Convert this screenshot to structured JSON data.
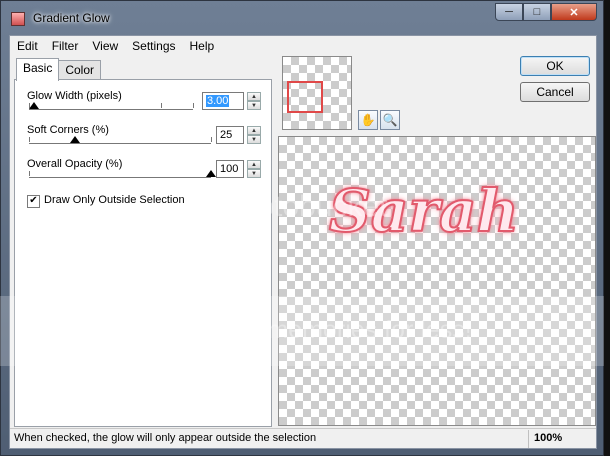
{
  "window": {
    "title": "Gradient Glow",
    "controls": {
      "minimize": "─",
      "maximize": "□",
      "close": "✕"
    }
  },
  "menu": [
    "Edit",
    "Filter",
    "View",
    "Settings",
    "Help"
  ],
  "tabs": {
    "basic": "Basic",
    "color": "Color"
  },
  "settings": {
    "glow_width": {
      "label": "Glow Width (pixels)",
      "value": "3.00",
      "level": 0.03
    },
    "soft_corners": {
      "label": "Soft Corners (%)",
      "value": "25",
      "level": 0.25
    },
    "overall_opacity": {
      "label": "Overall Opacity (%)",
      "value": "100",
      "level": 1.0
    },
    "draw_only_outside": {
      "label": "Draw Only Outside Selection",
      "checked": true
    }
  },
  "preview": {
    "text": "Sarah",
    "small_text": "Sarah",
    "glow_color": "#e25a6c"
  },
  "tools": {
    "hand": "✋",
    "zoom": "🔍"
  },
  "buttons": {
    "ok": "OK",
    "cancel": "Cancel"
  },
  "status": {
    "message": "When checked, the glow will only appear outside the selection",
    "zoom": "100%"
  },
  "watermark": {
    "line1": "photobucket",
    "line2": "Protect more of your memories for less!"
  }
}
